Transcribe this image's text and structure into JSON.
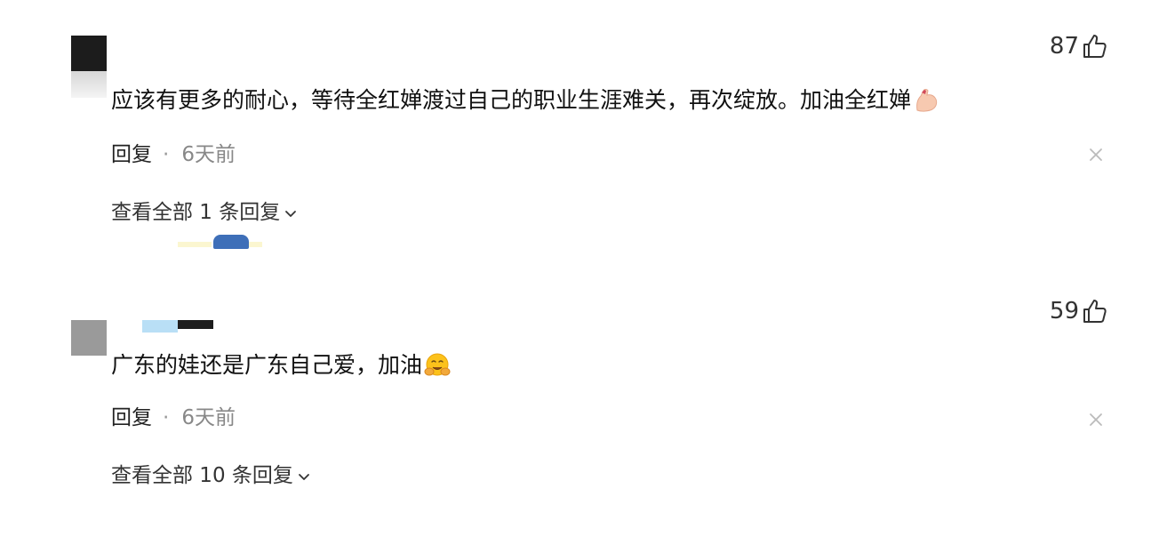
{
  "comments": [
    {
      "likes": "87",
      "text": "应该有更多的耐心，等待全红婵渡过自己的职业生涯难关，再次绽放。加油全红婵",
      "emoji_icon": "flexed-biceps-icon",
      "reply_label": "回复",
      "separator": "·",
      "time": "6天前",
      "view_all": "查看全部 1 条回复"
    },
    {
      "likes": "59",
      "text": "广东的娃还是广东自己爱，加油",
      "emoji_icon": "hugging-face-icon",
      "reply_label": "回复",
      "separator": "·",
      "time": "6天前",
      "view_all": "查看全部 10 条回复"
    }
  ],
  "icons": {
    "like": "thumbs-up-icon",
    "close": "close-icon",
    "expand": "chevron-down-icon"
  },
  "colors": {
    "text": "#111111",
    "meta": "#888888",
    "close": "#bbbbbb"
  }
}
